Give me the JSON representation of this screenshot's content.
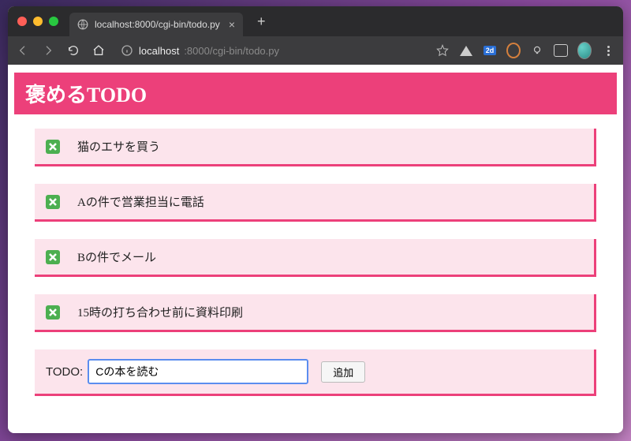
{
  "browser": {
    "tab_title": "localhost:8000/cgi-bin/todo.py",
    "url_host": "localhost",
    "url_rest": ":8000/cgi-bin/todo.py",
    "blue_badge": "2d"
  },
  "app": {
    "title": "褒めるTODO",
    "add_label": "TODO:",
    "add_input_value": "Cの本を読む",
    "add_button_label": "追加"
  },
  "todos": [
    {
      "text": "猫のエサを買う"
    },
    {
      "text": "Aの件で営業担当に電話"
    },
    {
      "text": "Bの件でメール"
    },
    {
      "text": "15時の打ち合わせ前に資料印刷"
    }
  ]
}
